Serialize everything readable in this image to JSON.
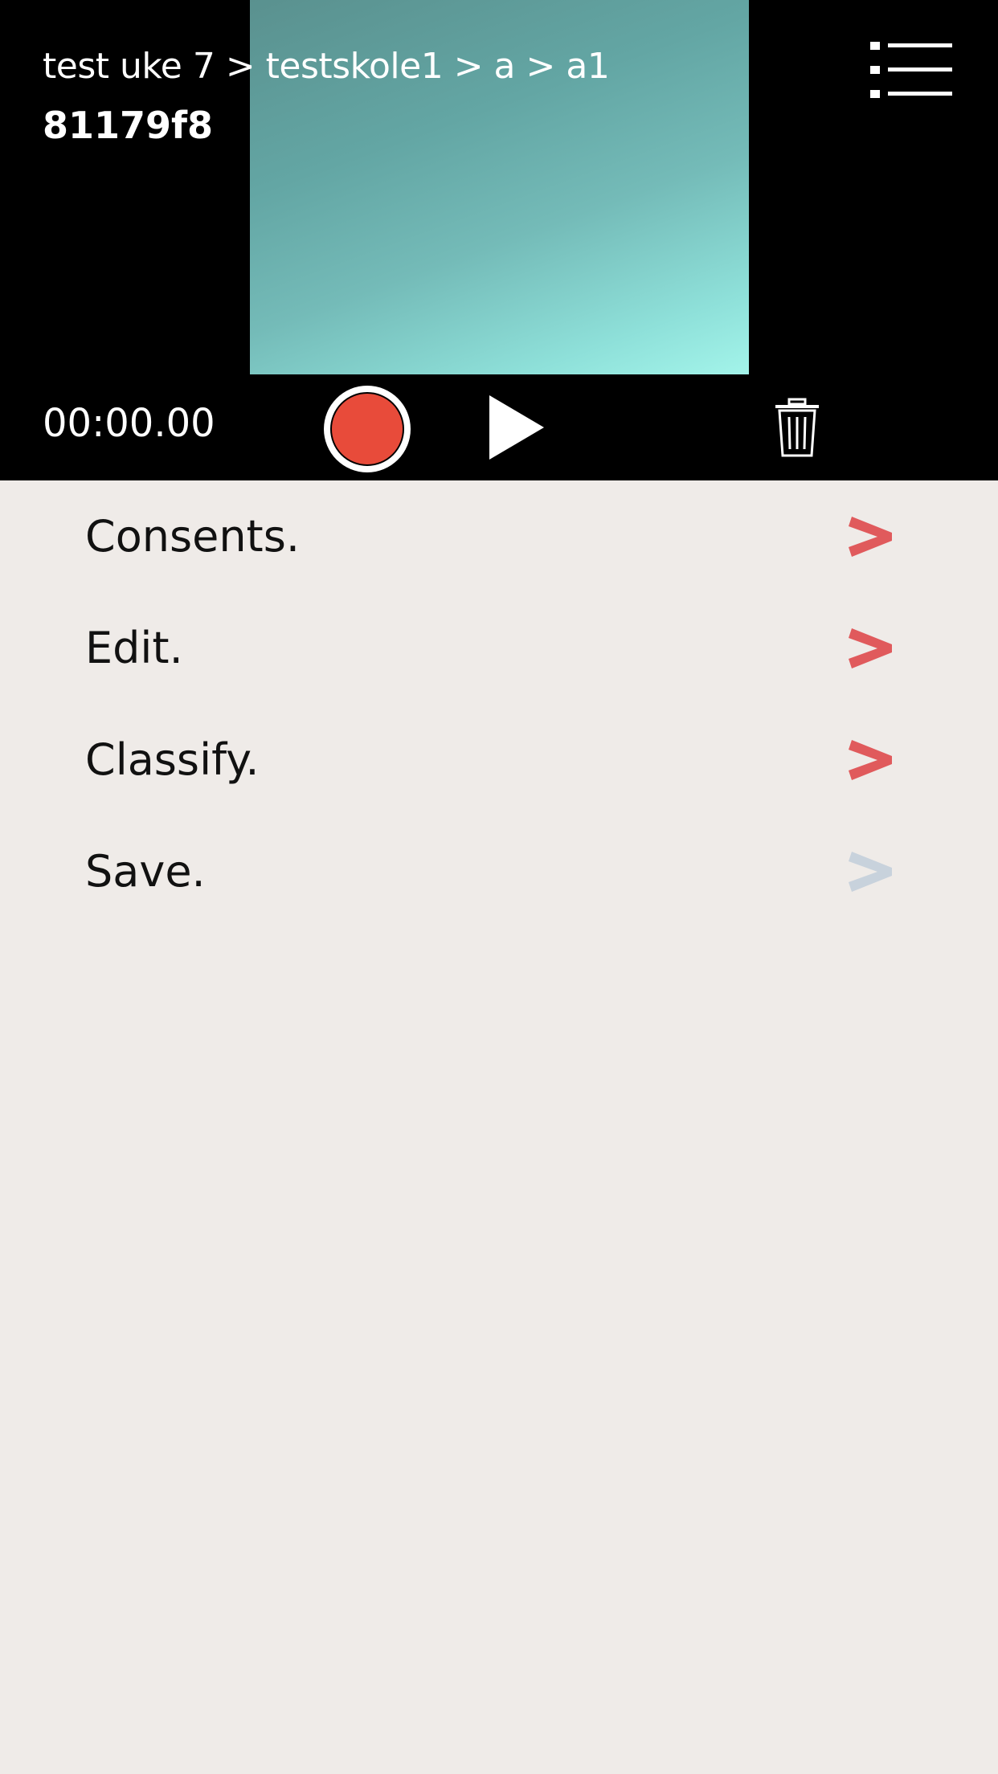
{
  "header": {
    "breadcrumb": "test uke 7 > testskole1 > a > a1",
    "session_id": "81179f8",
    "menu_icon": "list-menu-icon"
  },
  "recorder": {
    "timer": "00:00.00",
    "record_icon": "record-icon",
    "play_icon": "play-icon",
    "delete_icon": "trash-icon",
    "record_color": "#e84b3a"
  },
  "steps": [
    {
      "label": "Consents.",
      "chevron_color": "#e05a5c",
      "enabled": true
    },
    {
      "label": "Edit.",
      "chevron_color": "#e05a5c",
      "enabled": true
    },
    {
      "label": "Classify.",
      "chevron_color": "#e05a5c",
      "enabled": true
    },
    {
      "label": "Save.",
      "chevron_color": "#c8d2dc",
      "enabled": false
    }
  ],
  "colors": {
    "background": "#efebe8",
    "top_panel": "#000000",
    "accent": "#e05a5c",
    "disabled": "#c8d2dc"
  }
}
